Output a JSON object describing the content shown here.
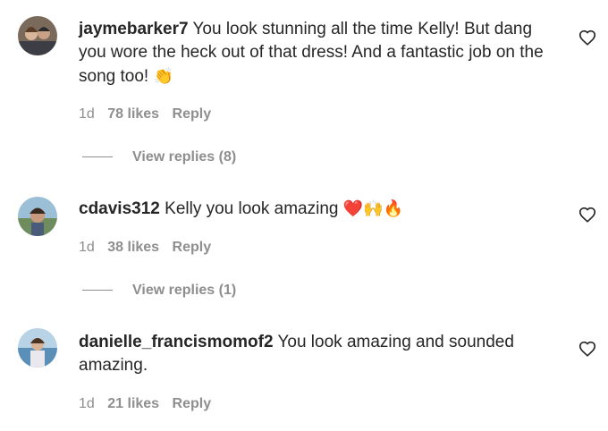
{
  "comments": [
    {
      "username": "jaymebarker7",
      "text": "You look stunning all the time Kelly! But dang you wore the heck out of that dress! And a fantastic job on the song too!",
      "emoji": "👏",
      "time": "1d",
      "likes": "78 likes",
      "reply": "Reply",
      "view_replies": "View replies (8)"
    },
    {
      "username": "cdavis312",
      "text": "Kelly you look amazing",
      "emoji": "❤️🙌🔥",
      "time": "1d",
      "likes": "38 likes",
      "reply": "Reply",
      "view_replies": "View replies (1)"
    },
    {
      "username": "danielle_francismomof2",
      "text": "You look amazing and sounded amazing.",
      "emoji": "",
      "time": "1d",
      "likes": "21 likes",
      "reply": "Reply"
    }
  ],
  "icons": {
    "like": "heart-outline-icon"
  },
  "colors": {
    "text": "#262626",
    "muted": "#8e8e8e"
  }
}
